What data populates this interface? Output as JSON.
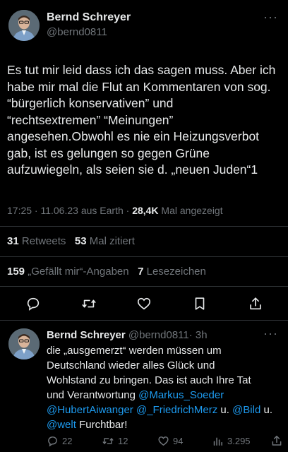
{
  "main_tweet": {
    "author_name": "Bernd Schreyer",
    "author_handle": "@bernd0811",
    "more": "···",
    "text_lines": [
      "Es tut mir leid dass ich das sagen muss. Aber ich",
      "habe mir mal die Flut an Kommentaren von sog.",
      "“bürgerlich konservativen” und",
      "“rechtsextremen” “Meinungen”",
      "angesehen.Obwohl es nie ein Heizungsverbot",
      "gab, ist es gelungen so gegen Grüne",
      "aufzuwiegeln, als seien sie d. „neuen Juden“1"
    ],
    "timestamp": "17:25 · 11.06.23 aus Earth · ",
    "views": "28,4K",
    "views_label": " Mal angezeigt",
    "retweets_count": "31",
    "retweets_label": "Retweets",
    "quotes_count": "53",
    "quotes_label": "Mal zitiert",
    "likes_count": "159",
    "likes_label": "„Gefällt mir“-Angaben",
    "bookmarks_count": "7",
    "bookmarks_label": "Lesezeichen"
  },
  "reply": {
    "author_name": "Bernd Schreyer",
    "author_handle": "@bernd0811",
    "time": "· 3h",
    "more": "···",
    "line1": "die „ausgemerzt“ werden müssen um",
    "line2": "Deutschland wieder alles Glück und",
    "line3": "Wohlstand zu bringen. Das ist auch Ihre Tat",
    "line4_text": "und Verantwortung ",
    "mention_soeder": "@Markus_Soeder",
    "mention_aiwanger": "@HubertAiwanger",
    "mention_merz": "@_FriedrichMerz",
    "text_u1": " u. ",
    "mention_bild": "@Bild",
    "text_u2": " u.",
    "mention_welt": "@welt",
    "text_end": " Furchtbar!",
    "replies": "22",
    "retweets": "12",
    "likes": "94",
    "views": "3.295"
  },
  "colors": {
    "accent": "#1d9bf0",
    "muted": "#71767b",
    "text": "#e7e9ea",
    "divider": "#2f3336"
  },
  "icons": [
    "reply-icon",
    "retweet-icon",
    "like-icon",
    "bookmark-icon",
    "share-icon",
    "views-icon"
  ]
}
